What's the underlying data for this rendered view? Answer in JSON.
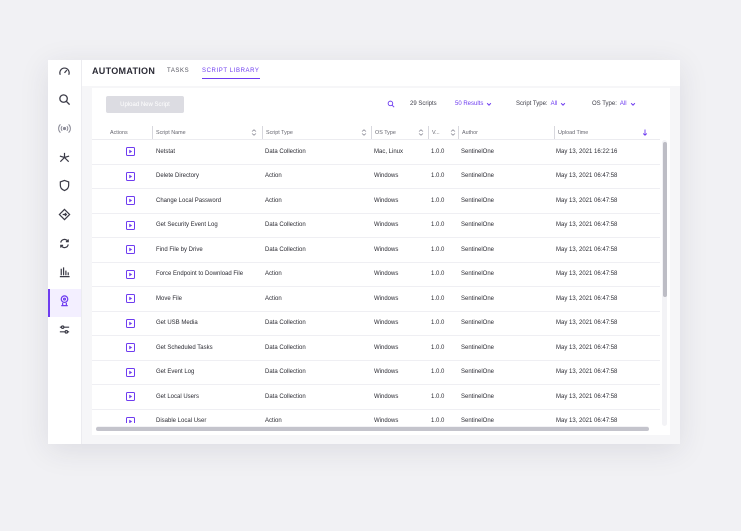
{
  "header": {
    "title": "AUTOMATION",
    "tabs": [
      {
        "label": "TASKS",
        "active": false
      },
      {
        "label": "SCRIPT LIBRARY",
        "active": true
      }
    ]
  },
  "sidebar": {
    "items": [
      {
        "icon": "dashboard-gauge-icon",
        "active": false
      },
      {
        "icon": "search-icon",
        "active": false
      },
      {
        "icon": "broadcast-icon",
        "active": false
      },
      {
        "icon": "asterisk-icon",
        "active": false
      },
      {
        "icon": "shield-icon",
        "active": false
      },
      {
        "icon": "diamond-arrows-icon",
        "active": false
      },
      {
        "icon": "sync-icon",
        "active": false
      },
      {
        "icon": "bar-chart-icon",
        "active": false
      },
      {
        "icon": "automation-robot-icon",
        "active": true
      },
      {
        "icon": "sliders-icon",
        "active": false
      }
    ]
  },
  "toolbar": {
    "upload_label": "Upload New Script",
    "scripts_count": "29 Scripts",
    "results_label": "50 Results",
    "script_type_label": "Script Type:",
    "script_type_value": "All",
    "os_type_label": "OS Type:",
    "os_type_value": "All"
  },
  "table": {
    "columns": [
      "Actions",
      "Script Name",
      "Script Type",
      "OS Type",
      "V...",
      "Author",
      "Upload Time"
    ],
    "rows": [
      {
        "name": "Netstat",
        "type": "Data Collection",
        "os": "Mac, Linux",
        "version": "1.0.0",
        "author": "SentinelOne",
        "upload_time": "May 13, 2021 16:22:16"
      },
      {
        "name": "Delete Directory",
        "type": "Action",
        "os": "Windows",
        "version": "1.0.0",
        "author": "SentinelOne",
        "upload_time": "May 13, 2021 06:47:58"
      },
      {
        "name": "Change Local Password",
        "type": "Action",
        "os": "Windows",
        "version": "1.0.0",
        "author": "SentinelOne",
        "upload_time": "May 13, 2021 06:47:58"
      },
      {
        "name": "Get Security Event Log",
        "type": "Data Collection",
        "os": "Windows",
        "version": "1.0.0",
        "author": "SentinelOne",
        "upload_time": "May 13, 2021 06:47:58"
      },
      {
        "name": "Find File by Drive",
        "type": "Data Collection",
        "os": "Windows",
        "version": "1.0.0",
        "author": "SentinelOne",
        "upload_time": "May 13, 2021 06:47:58"
      },
      {
        "name": "Force Endpoint to Download File",
        "type": "Action",
        "os": "Windows",
        "version": "1.0.0",
        "author": "SentinelOne",
        "upload_time": "May 13, 2021 06:47:58"
      },
      {
        "name": "Move File",
        "type": "Action",
        "os": "Windows",
        "version": "1.0.0",
        "author": "SentinelOne",
        "upload_time": "May 13, 2021 06:47:58"
      },
      {
        "name": "Get USB Media",
        "type": "Data Collection",
        "os": "Windows",
        "version": "1.0.0",
        "author": "SentinelOne",
        "upload_time": "May 13, 2021 06:47:58"
      },
      {
        "name": "Get Scheduled Tasks",
        "type": "Data Collection",
        "os": "Windows",
        "version": "1.0.0",
        "author": "SentinelOne",
        "upload_time": "May 13, 2021 06:47:58"
      },
      {
        "name": "Get Event Log",
        "type": "Data Collection",
        "os": "Windows",
        "version": "1.0.0",
        "author": "SentinelOne",
        "upload_time": "May 13, 2021 06:47:58"
      },
      {
        "name": "Get Local Users",
        "type": "Data Collection",
        "os": "Windows",
        "version": "1.0.0",
        "author": "SentinelOne",
        "upload_time": "May 13, 2021 06:47:58"
      },
      {
        "name": "Disable Local User",
        "type": "Action",
        "os": "Windows",
        "version": "1.0.0",
        "author": "SentinelOne",
        "upload_time": "May 13, 2021 06:47:58"
      }
    ]
  },
  "colors": {
    "accent": "#6e3cf0",
    "background": "#f1f1f4",
    "button_disabled": "#dcdce2"
  }
}
